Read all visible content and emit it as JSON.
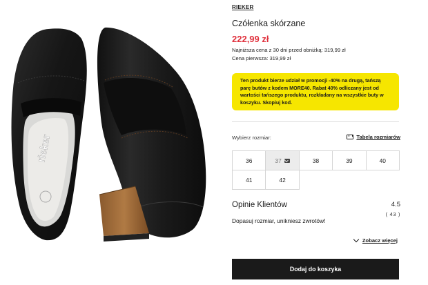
{
  "product": {
    "brand": "RIEKER",
    "title": "Czółenka skórzane",
    "price": "222,99 zł",
    "lowest_price": "Najniższa cena z 30 dni przed obniżką: 319,99 zł",
    "first_price": "Cena pierwsza: 319,99 zł",
    "insole_logo": "rieker"
  },
  "promo": {
    "line1": "Ten produkt bierze udział w promocji -40% na drugą, tańszą",
    "line2": "parę butów z kodem MORE40. Rabat 40% odliczany jest od",
    "line3": "wartości tańszego produktu, rozkładany na wszystkie buty w",
    "line4": "koszyku. Skopiuj kod.",
    "background_color": "#f6e600"
  },
  "size_selector": {
    "label": "Wybierz rozmiar:",
    "size_chart_label": "Tabela rozmiarów",
    "size_chart_icon": "ruler-icon",
    "sizes": [
      {
        "label": "36",
        "available": true
      },
      {
        "label": "37",
        "available": false,
        "icon": "mail-icon"
      },
      {
        "label": "38",
        "available": true
      },
      {
        "label": "39",
        "available": true
      },
      {
        "label": "40",
        "available": true
      },
      {
        "label": "41",
        "available": true
      },
      {
        "label": "42",
        "available": true
      }
    ]
  },
  "reviews": {
    "title": "Opinie Klientów",
    "rating": "4.5",
    "count": "( 43 )",
    "text": "Dopasuj rozmiar, unikniesz zwrotów!",
    "see_more": "Zobacz więcej"
  },
  "cart": {
    "button_label": "Dodaj do koszyka"
  },
  "colors": {
    "price": "#e0313d",
    "button": "#1a1a1a",
    "promo": "#f6e600"
  }
}
